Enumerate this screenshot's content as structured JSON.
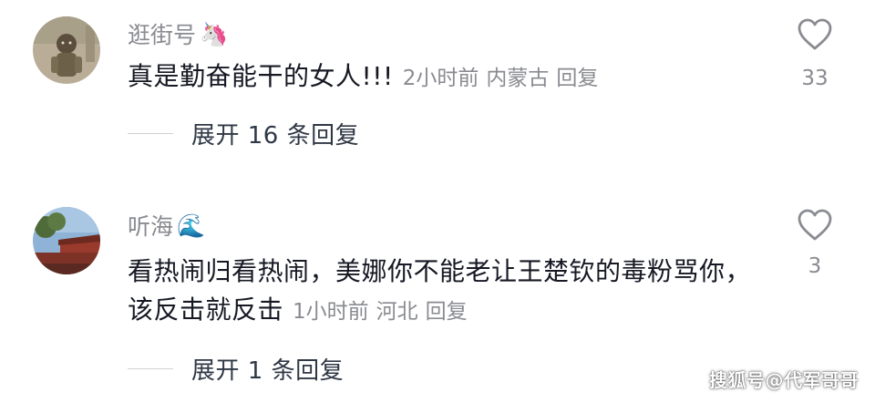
{
  "comments": [
    {
      "username": "逛街号",
      "username_emoji": "🦄",
      "text": "真是勤奋能干的女人!!!",
      "time": "2小时前",
      "location": "内蒙古",
      "reply_label": "回复",
      "like_count": "33",
      "expand_label": "展开 16 条回复"
    },
    {
      "username": "听海",
      "username_emoji": "🌊",
      "text": "看热闹归看热闹，美娜你不能老让王楚钦的毒粉骂你，该反击就反击",
      "time": "1小时前",
      "location": "河北",
      "reply_label": "回复",
      "like_count": "3",
      "expand_label": "展开 1 条回复"
    }
  ],
  "icons": {
    "like": "heart-outline-icon"
  },
  "colors": {
    "text": "#161823",
    "meta": "#8a8b91",
    "expand": "#2f3845"
  },
  "watermark": "搜狐号@代军哥哥"
}
